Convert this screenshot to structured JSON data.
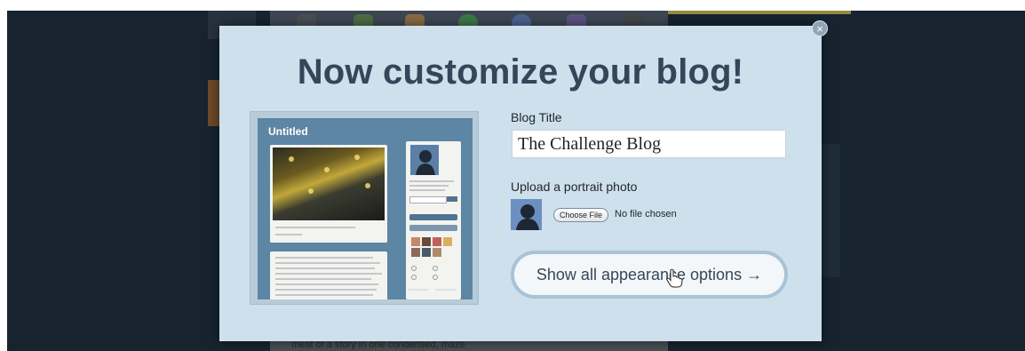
{
  "modal": {
    "title": "Now customize your blog!",
    "close_symbol": "×",
    "blog_title_label": "Blog Title",
    "blog_title_value": "The Challenge Blog",
    "portrait_label": "Upload a portrait photo",
    "choose_file_label": "Choose File",
    "no_file_text": "No file chosen",
    "show_all_label": "Show all appearance options →"
  },
  "preview": {
    "blog_title": "Untitled"
  },
  "background": {
    "bottom_text": "meat of a story in one condensed, maze"
  },
  "icons": [
    "close-icon",
    "portrait-silhouette-icon",
    "hand-pointer-cursor-icon"
  ],
  "colors": {
    "modal_bg": "#cde0ec",
    "title_text": "#36465a",
    "overlay": "#17232f",
    "preview_accent": "#5c86a3"
  }
}
